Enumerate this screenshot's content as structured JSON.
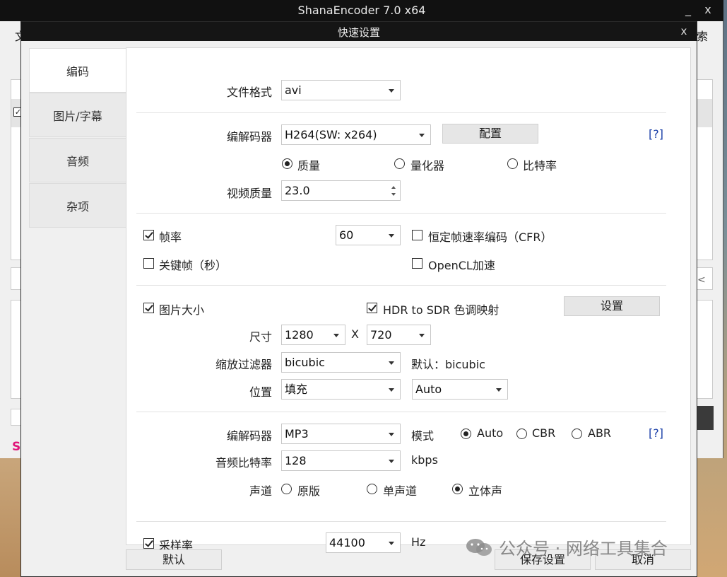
{
  "main_window": {
    "title": "ShanaEncoder 7.0 x64",
    "min_glyph": "_",
    "close_glyph": "x",
    "menu_left": "文",
    "menu_right": "索",
    "brand": "S",
    "side_glyph": "<"
  },
  "dialog": {
    "title": "快速设置",
    "close_glyph": "x"
  },
  "sidebar": {
    "items": [
      {
        "label": "编码"
      },
      {
        "label": "图片/字幕"
      },
      {
        "label": "音频"
      },
      {
        "label": "杂项"
      }
    ]
  },
  "format": {
    "label": "文件格式",
    "value": "avi"
  },
  "video": {
    "codec_label": "编解码器",
    "codec_value": "H264(SW: x264)",
    "config_button": "配置",
    "help": "[?]",
    "mode_quality": "质量",
    "mode_quantizer": "量化器",
    "mode_bitrate": "比特率",
    "quality_label": "视频质量",
    "quality_value": "23.0"
  },
  "frames": {
    "framerate_label": "帧率",
    "framerate_value": "60",
    "cfr_label": "恒定帧速率编码（CFR）",
    "keyframe_label": "关键帧（秒）",
    "opencl_label": "OpenCL加速"
  },
  "picture": {
    "size_label": "图片大小",
    "hdr_label": "HDR to SDR 色调映射",
    "settings_button": "设置",
    "dim_label": "尺寸",
    "width": "1280",
    "x_sep": "X",
    "height": "720",
    "filter_label": "缩放过滤器",
    "filter_value": "bicubic",
    "filter_default": "默认：bicubic",
    "position_label": "位置",
    "position_value": "填充",
    "position_auto": "Auto"
  },
  "audio": {
    "codec_label": "编解码器",
    "codec_value": "MP3",
    "mode_label": "模式",
    "mode_auto": "Auto",
    "mode_cbr": "CBR",
    "mode_abr": "ABR",
    "help": "[?]",
    "bitrate_label": "音频比特率",
    "bitrate_value": "128",
    "bitrate_unit": "kbps",
    "channel_label": "声道",
    "ch_original": "原版",
    "ch_mono": "单声道",
    "ch_stereo": "立体声",
    "samplerate_label": "采样率",
    "samplerate_value": "44100",
    "samplerate_unit": "Hz"
  },
  "footer": {
    "default_button": "默认",
    "save_button": "保存设置",
    "cancel_button": "取消"
  },
  "watermark": {
    "text": "公众号 · 网络工具集合"
  }
}
